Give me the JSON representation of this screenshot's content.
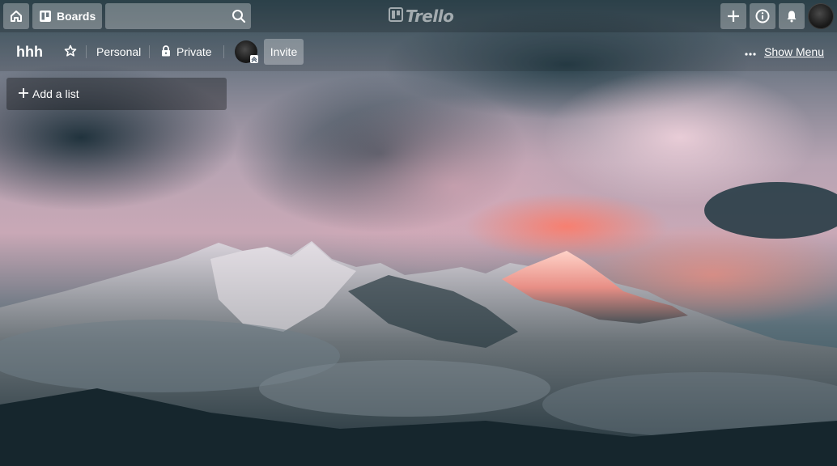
{
  "topbar": {
    "home_icon": "home-icon",
    "boards_label": "Boards",
    "boards_icon": "board-icon",
    "search": {
      "value": "",
      "placeholder": ""
    },
    "search_icon": "search-icon",
    "logo_text": "Trello",
    "add_icon": "plus-icon",
    "info_icon": "info-icon",
    "notifications_icon": "bell-icon"
  },
  "board": {
    "title": "hhh",
    "star_icon": "star-icon",
    "team_label": "Personal",
    "visibility_label": "Private",
    "visibility_icon": "lock-icon",
    "invite_label": "Invite",
    "menu_label": "Show Menu",
    "menu_icon": "ellipsis-icon"
  },
  "lists": {
    "add_list_label": "Add a list"
  },
  "colors": {
    "header_overlay": "rgba(0,0,0,0.28)",
    "button_bg": "rgba(255,255,255,0.3)",
    "text": "#ffffff"
  }
}
